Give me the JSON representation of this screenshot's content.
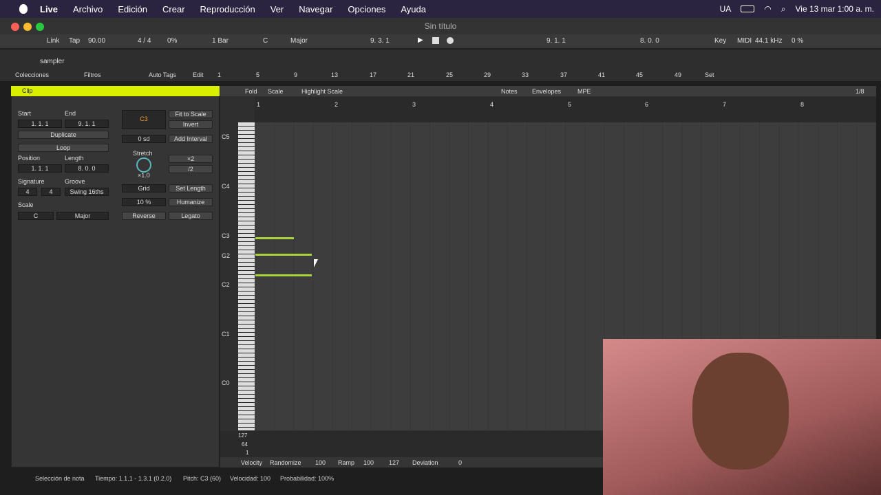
{
  "menubar": {
    "apple": "",
    "app": "Live",
    "items": [
      "Archivo",
      "Edición",
      "Crear",
      "Reproducción",
      "Ver",
      "Navegar",
      "Opciones",
      "Ayuda"
    ],
    "lang": "UA",
    "datetime": "Vie 13 mar  1:00 a. m."
  },
  "window": {
    "title": "Sin título"
  },
  "transport": {
    "link": "Link",
    "tap": "Tap",
    "tempo": "90.00",
    "sig": "4 / 4",
    "pct1": "0%",
    "quant": "1 Bar",
    "key": "C",
    "scale": "Major",
    "pos": "9.  3.  1",
    "pos2": "9.  1.  1",
    "pos3": "8.  0.  0",
    "keyL": "Key",
    "midiL": "MIDI",
    "rate": "44.1 kHz",
    "cpu": "0 %"
  },
  "browser": {
    "search": "sampler",
    "colecciones": "Colecciones",
    "filtros": "Filtros",
    "autotags": "Auto Tags",
    "edit": "Edit",
    "set": "Set"
  },
  "ruler_top": [
    "1",
    "5",
    "9",
    "13",
    "17",
    "21",
    "25",
    "29",
    "33",
    "37",
    "41",
    "45",
    "49"
  ],
  "clip": {
    "header": "Clip",
    "start": "Start",
    "set": "Set",
    "end": "End",
    "start_v": "1.  1.  1",
    "end_v": "9.  1.  1",
    "duplicate": "Duplicate",
    "loop": "Loop",
    "position": "Position",
    "length": "Length",
    "pos_v": "1.  1.  1",
    "len_v": "8.  0.  0",
    "signature": "Signature",
    "groove": "Groove",
    "sig_n": "4",
    "sig_d": "4",
    "swing": "Swing 16ths",
    "scale": "Scale",
    "scale_root": "C",
    "scale_mode": "Major",
    "note_disp": "C3",
    "fit": "Fit to Scale",
    "invert": "Invert",
    "semi": "0 sd",
    "add_int": "Add Interval",
    "stretch": "Stretch",
    "x2": "×2",
    "half": "/2",
    "stretch_v": "×1.0",
    "grid": "Grid",
    "setlen": "Set Length",
    "pct": "10 %",
    "humanize": "Humanize",
    "reverse": "Reverse",
    "legato": "Legato"
  },
  "editor": {
    "fold": "Fold",
    "scale": "Scale",
    "highlight": "Highlight Scale",
    "notes": "Notes",
    "envelopes": "Envelopes",
    "mpe": "MPE",
    "grid": "1/8",
    "bars": [
      "1",
      "2",
      "3",
      "4",
      "5",
      "6",
      "7",
      "8"
    ],
    "keys": [
      "C5",
      "C4",
      "C3",
      "G2",
      "C2",
      "C1",
      "C0"
    ],
    "vel": [
      "127",
      "64",
      "1"
    ]
  },
  "velbar": {
    "velocity": "Velocity",
    "randomize": "Randomize",
    "rand_v": "100",
    "ramp": "Ramp",
    "ramp_v": "100",
    "ramp_v2": "127",
    "deviation": "Deviation",
    "dev_v": "0"
  },
  "status": {
    "a": "Selección de nota",
    "b": "Tiempo: 1.1.1 - 1.3.1 (0.2.0)",
    "c": "Pitch: C3 (60)",
    "d": "Velocidad: 100",
    "e": "Probabilidad: 100%"
  }
}
